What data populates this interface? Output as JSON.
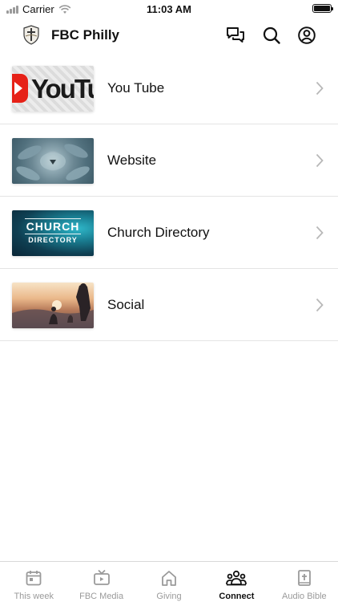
{
  "status": {
    "carrier": "Carrier",
    "time": "11:03 AM"
  },
  "header": {
    "title": "FBC Philly",
    "icons": [
      "logo-icon",
      "chat-icon",
      "search-icon",
      "account-icon"
    ]
  },
  "list": {
    "items": [
      {
        "label": "You Tube",
        "thumb_text": "YouTu"
      },
      {
        "label": "Website"
      },
      {
        "label": "Church Directory",
        "thumb_text_1": "CHURCH",
        "thumb_text_2": "DIRECTORY"
      },
      {
        "label": "Social"
      }
    ]
  },
  "tabs": [
    {
      "label": "This week",
      "icon": "calendar-icon",
      "active": false
    },
    {
      "label": "FBC Media",
      "icon": "tv-icon",
      "active": false
    },
    {
      "label": "Giving",
      "icon": "home-icon",
      "active": false
    },
    {
      "label": "Connect",
      "icon": "people-icon",
      "active": true
    },
    {
      "label": "Audio Bible",
      "icon": "bible-icon",
      "active": false
    }
  ],
  "colors": {
    "accent": "#111111",
    "inactive": "#9a9a9a",
    "divider": "#e4e4e4",
    "youtube_red": "#e62117"
  }
}
